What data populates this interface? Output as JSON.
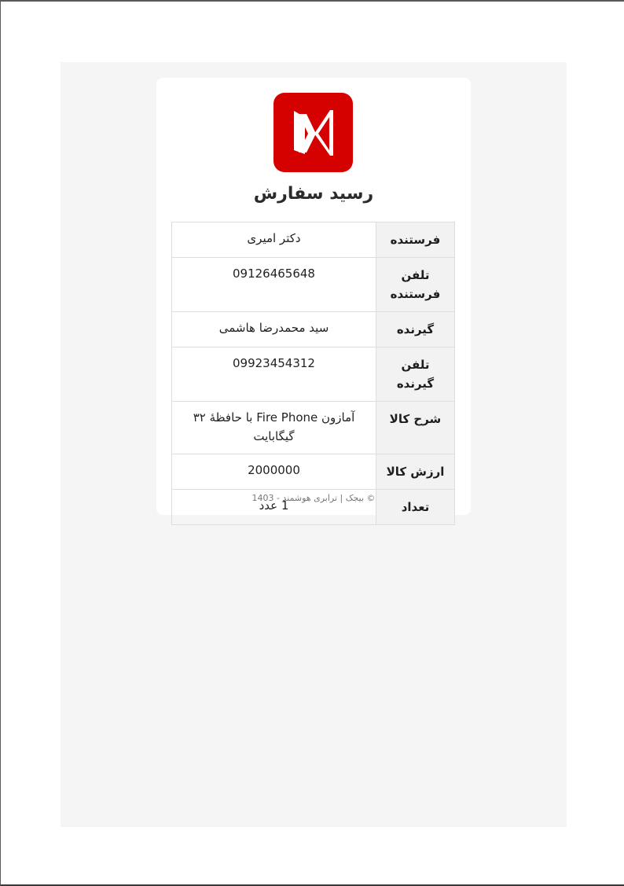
{
  "receipt": {
    "title": "رسید سفارش",
    "rows": [
      {
        "label": "فرستنده",
        "value": "دکتر امیری"
      },
      {
        "label": "تلفن فرستنده",
        "value": "09126465648"
      },
      {
        "label": "گیرنده",
        "value": "سید محمدرضا هاشمی"
      },
      {
        "label": "تلفن گیرنده",
        "value": "09923454312"
      },
      {
        "label": "شرح کالا",
        "value": "آمازون Fire Phone با حافظهٔ ۳۲ گیگابایت"
      },
      {
        "label": "ارزش کالا",
        "value": "2000000"
      },
      {
        "label": "تعداد",
        "value": "1 عدد"
      }
    ],
    "footer": "© بیجک | ترابری هوشمند - 1403"
  },
  "colors": {
    "brand": "#d50000",
    "page_background": "#f5f5f5",
    "label_background": "#f2f2f2",
    "border": "#dddddd"
  },
  "icons": {
    "logo": "bijak-logo-icon"
  }
}
